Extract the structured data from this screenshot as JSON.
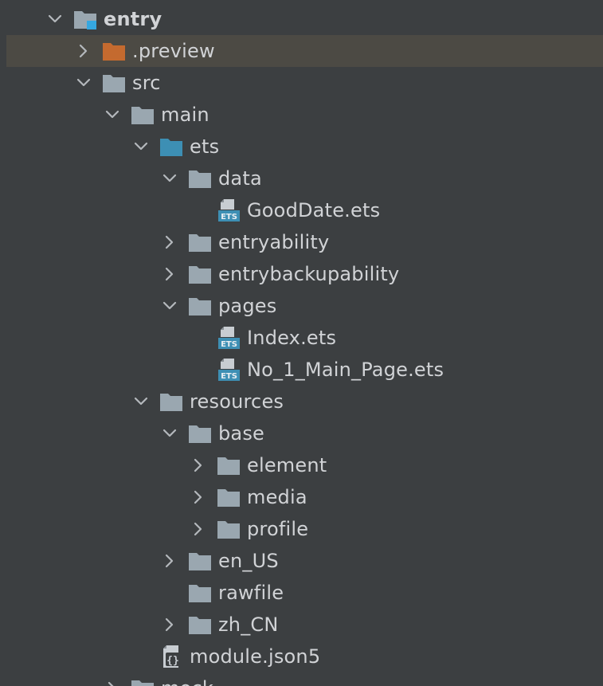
{
  "theme": {
    "background": "#3c3f41",
    "selection": "#4c4a44",
    "text": "#d1d3d6",
    "folder_color": "#9aa7b0",
    "source_folder_color": "#3d8fb4",
    "excluded_folder_color": "#c46a2f",
    "arrow_color": "#b4b8bc"
  },
  "tree": [
    {
      "label": "entry",
      "depth": 0,
      "expandable": true,
      "expanded": true,
      "icon": "module-folder-icon",
      "bold": true
    },
    {
      "label": ".preview",
      "depth": 1,
      "expandable": true,
      "expanded": false,
      "icon": "excluded-folder-icon",
      "selected": true
    },
    {
      "label": "src",
      "depth": 1,
      "expandable": true,
      "expanded": true,
      "icon": "folder-icon"
    },
    {
      "label": "main",
      "depth": 2,
      "expandable": true,
      "expanded": true,
      "icon": "folder-icon"
    },
    {
      "label": "ets",
      "depth": 3,
      "expandable": true,
      "expanded": true,
      "icon": "source-folder-icon"
    },
    {
      "label": "data",
      "depth": 4,
      "expandable": true,
      "expanded": true,
      "icon": "folder-icon"
    },
    {
      "label": "GoodDate.ets",
      "depth": 5,
      "expandable": false,
      "icon": "ets-file-icon"
    },
    {
      "label": "entryability",
      "depth": 4,
      "expandable": true,
      "expanded": false,
      "icon": "folder-icon"
    },
    {
      "label": "entrybackupability",
      "depth": 4,
      "expandable": true,
      "expanded": false,
      "icon": "folder-icon"
    },
    {
      "label": "pages",
      "depth": 4,
      "expandable": true,
      "expanded": true,
      "icon": "folder-icon"
    },
    {
      "label": "Index.ets",
      "depth": 5,
      "expandable": false,
      "icon": "ets-file-icon"
    },
    {
      "label": "No_1_Main_Page.ets",
      "depth": 5,
      "expandable": false,
      "icon": "ets-file-icon"
    },
    {
      "label": "resources",
      "depth": 3,
      "expandable": true,
      "expanded": true,
      "icon": "folder-icon"
    },
    {
      "label": "base",
      "depth": 4,
      "expandable": true,
      "expanded": true,
      "icon": "folder-icon"
    },
    {
      "label": "element",
      "depth": 5,
      "expandable": true,
      "expanded": false,
      "icon": "folder-icon"
    },
    {
      "label": "media",
      "depth": 5,
      "expandable": true,
      "expanded": false,
      "icon": "folder-icon"
    },
    {
      "label": "profile",
      "depth": 5,
      "expandable": true,
      "expanded": false,
      "icon": "folder-icon"
    },
    {
      "label": "en_US",
      "depth": 4,
      "expandable": true,
      "expanded": false,
      "icon": "folder-icon"
    },
    {
      "label": "rawfile",
      "depth": 4,
      "expandable": false,
      "icon": "folder-icon"
    },
    {
      "label": "zh_CN",
      "depth": 4,
      "expandable": true,
      "expanded": false,
      "icon": "folder-icon"
    },
    {
      "label": "module.json5",
      "depth": 3,
      "expandable": false,
      "icon": "json-file-icon"
    },
    {
      "label": "mock",
      "depth": 2,
      "expandable": true,
      "expanded": false,
      "icon": "folder-icon"
    }
  ]
}
